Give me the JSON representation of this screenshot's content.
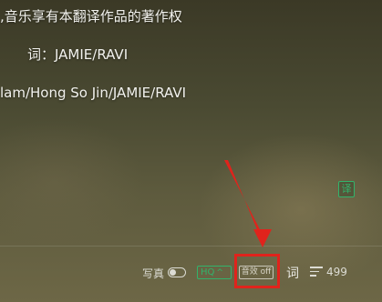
{
  "lyrics": {
    "line1": ",音乐享有本翻译作品的著作权",
    "line2": "词：JAMIE/RAVI",
    "line3": "lam/Hong So Jin/JAMIE/RAVI"
  },
  "translate_button": {
    "label": "译"
  },
  "toolbar": {
    "photo_label": "写真",
    "photo_toggle_on": false,
    "quality_label": "HQ",
    "quality_chevron": "^",
    "effect_label": "音效 off",
    "lyric_label": "词",
    "playlist_count": "499"
  },
  "annotation": {
    "color": "#e0231c"
  },
  "colors": {
    "accent_green": "#32b36b"
  }
}
